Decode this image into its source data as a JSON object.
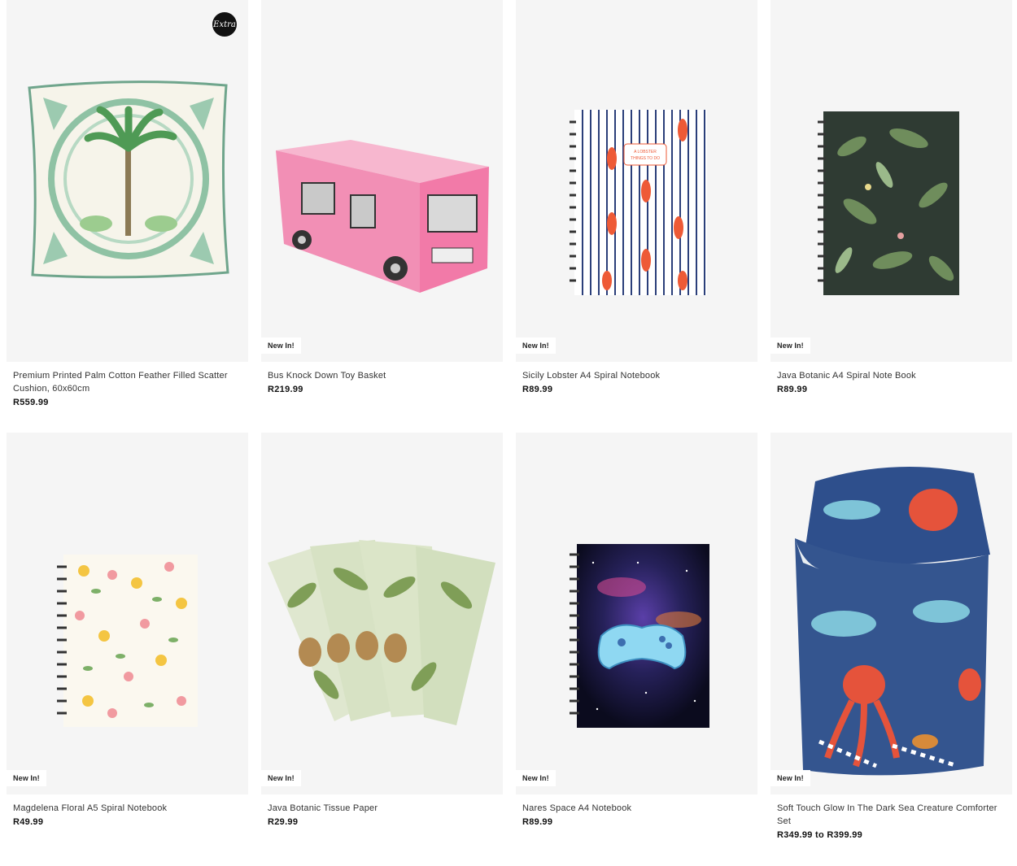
{
  "products": [
    {
      "name": "Premium Printed Palm Cotton Feather Filled Scatter Cushion, 60x60cm",
      "price": "R559.99",
      "badge": "",
      "logo": "Extra",
      "image": "palm-cushion-image"
    },
    {
      "name": "Bus Knock Down Toy Basket",
      "price": "R219.99",
      "badge": "New In!",
      "image": "bus-basket-image"
    },
    {
      "name": "Sicily Lobster A4 Spiral Notebook",
      "price": "R89.99",
      "badge": "New In!",
      "image": "lobster-notebook-image",
      "cover_text": "A LOBSTER THINGS TO DO"
    },
    {
      "name": "Java Botanic A4 Spiral Note Book",
      "price": "R89.99",
      "badge": "New In!",
      "image": "botanic-notebook-image"
    },
    {
      "name": "Magdelena Floral A5 Spiral Notebook",
      "price": "R49.99",
      "badge": "New In!",
      "image": "floral-notebook-image"
    },
    {
      "name": "Java Botanic Tissue Paper",
      "price": "R29.99",
      "badge": "New In!",
      "image": "tissue-paper-image"
    },
    {
      "name": "Nares Space A4 Notebook",
      "price": "R89.99",
      "badge": "New In!",
      "image": "space-notebook-image"
    },
    {
      "name": "Soft Touch Glow In The Dark Sea Creature Comforter Set",
      "price": "R349.99 to R399.99",
      "badge": "New In!",
      "image": "sea-comforter-image"
    }
  ],
  "colors": {
    "card_bg": "#f5f5f5",
    "text": "#333333",
    "price": "#111111"
  }
}
